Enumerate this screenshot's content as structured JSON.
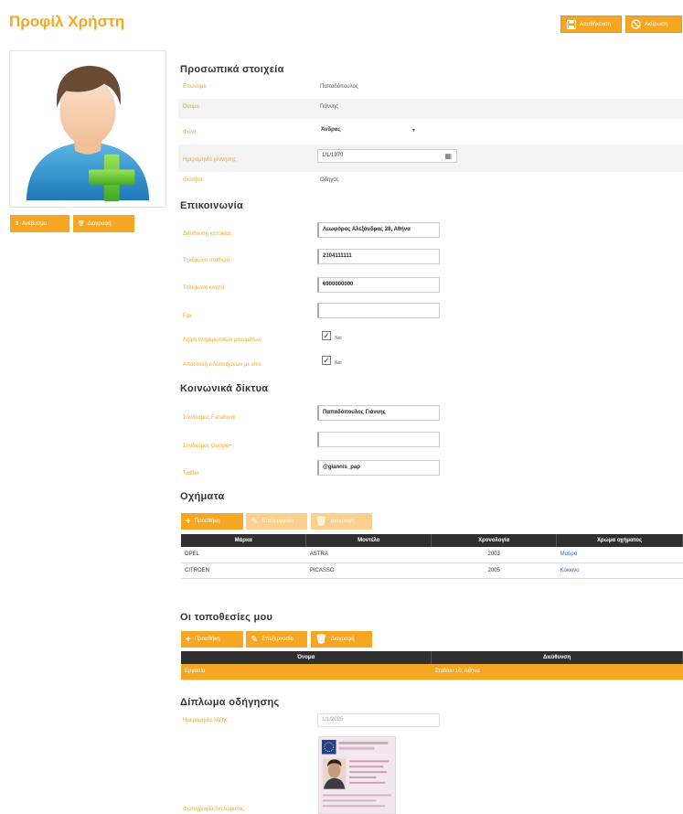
{
  "header": {
    "title": "Προφίλ Χρήστη",
    "save_label": "Αποθήκευση",
    "cancel_label": "Ακύρωση"
  },
  "photo": {
    "upload_label": "Ανέβασμα",
    "delete_label": "Διαγραφή"
  },
  "personal": {
    "title": "Προσωπικά στοιχεία",
    "rows": [
      {
        "label": "Επώνυμο",
        "value": "Παπαδόπουλος"
      },
      {
        "label": "Όνομα",
        "value": "Γιάννης"
      },
      {
        "label": "Φύλο",
        "value": "Άνδρας"
      },
      {
        "label": "Ημερομηνία γέννησης",
        "value": "1/1/1970"
      },
      {
        "label": "Ιδιότητα",
        "value": "Οδηγός"
      }
    ]
  },
  "contact": {
    "title": "Επικοινωνία",
    "rows": [
      {
        "label": "Διεύθυνση κατοικίας",
        "value": "Λεωφόρος Αλεξάνδρας 28, Αθήνα"
      },
      {
        "label": "Τηλέφωνο σταθερό",
        "value": "2104111111"
      },
      {
        "label": "Τηλέφωνο κινητό",
        "value": "6900000000"
      },
      {
        "label": "Fax",
        "value": ""
      }
    ],
    "check_rows": [
      {
        "label": "Λήψη ενημερωτικών μηνυμάτων",
        "note": "Ναι",
        "mark": "✓"
      },
      {
        "label": "Αποστολή ειδοποιήσεων με sms",
        "note": "Ναι",
        "mark": "✓"
      }
    ]
  },
  "social": {
    "title": "Κοινωνικά δίκτυα",
    "rows": [
      {
        "label": "Σύνδεσμος Facebook",
        "value": "Παπαδόπουλος Γιάννης"
      },
      {
        "label": "Σύνδεσμος Google+",
        "value": ""
      },
      {
        "label": "Twitter",
        "value": "@giannis_pap"
      }
    ]
  },
  "vehicles": {
    "title": "Οχήματα",
    "add_label": "Προσθήκη",
    "edit_label": "Επεξεργασία",
    "delete_label": "Διαγραφή",
    "columns": [
      "Μάρκα",
      "Μοντέλο",
      "Χρονολογία",
      "Χρώμα οχήματος"
    ],
    "rows": [
      [
        "OPEL",
        "ASTRA",
        "2003",
        "Μαύρο"
      ],
      [
        "CITROEN",
        "PICASSO",
        "2005",
        "Κόκκινο"
      ]
    ]
  },
  "locations": {
    "title": "Οι τοποθεσίες μου",
    "add_label": "Προσθήκη",
    "edit_label": "Επεξεργασία",
    "delete_label": "Διαγραφή",
    "columns": [
      "Όνομα",
      "Διεύθυνση"
    ],
    "rows": [
      [
        "Εργασία",
        "Σταδίου 10, Αθήνα"
      ]
    ]
  },
  "license": {
    "title": "Δίπλωμα οδήγησης",
    "expiry_label": "Ημερομηνία λήξης",
    "expiry_value": "1/1/2025",
    "image_label": "Φωτογραφία διπλώματος"
  },
  "colors": {
    "accent": "#f5a623",
    "table_header": "#2f2f2f",
    "link": "#2a6db6"
  }
}
